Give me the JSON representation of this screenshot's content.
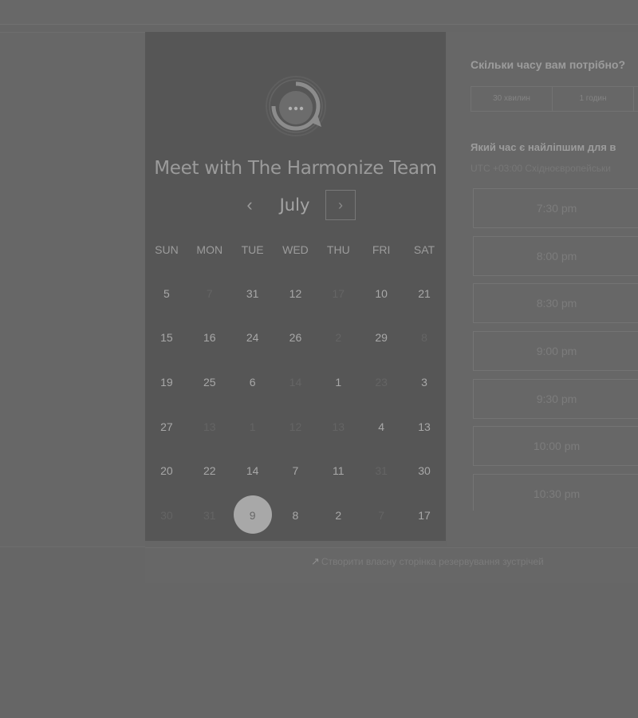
{
  "calendar": {
    "title": "Meet with The Harmonize Team",
    "month": "July",
    "prev_label": "‹",
    "next_label": "›",
    "weekdays": [
      "SUN",
      "MON",
      "TUE",
      "WED",
      "THU",
      "FRI",
      "SAT"
    ],
    "weeks": [
      [
        {
          "d": "5",
          "dim": false
        },
        {
          "d": "7",
          "dim": true
        },
        {
          "d": "31",
          "dim": false
        },
        {
          "d": "12",
          "dim": false
        },
        {
          "d": "17",
          "dim": true
        },
        {
          "d": "10",
          "dim": false
        },
        {
          "d": "21",
          "dim": false
        }
      ],
      [
        {
          "d": "15",
          "dim": false
        },
        {
          "d": "16",
          "dim": false
        },
        {
          "d": "24",
          "dim": false
        },
        {
          "d": "26",
          "dim": false
        },
        {
          "d": "2",
          "dim": true
        },
        {
          "d": "29",
          "dim": false
        },
        {
          "d": "8",
          "dim": true
        }
      ],
      [
        {
          "d": "19",
          "dim": false
        },
        {
          "d": "25",
          "dim": false
        },
        {
          "d": "6",
          "dim": false
        },
        {
          "d": "14",
          "dim": true
        },
        {
          "d": "1",
          "dim": false
        },
        {
          "d": "23",
          "dim": true
        },
        {
          "d": "3",
          "dim": false
        }
      ],
      [
        {
          "d": "27",
          "dim": false
        },
        {
          "d": "13",
          "dim": true
        },
        {
          "d": "1",
          "dim": true
        },
        {
          "d": "12",
          "dim": true
        },
        {
          "d": "13",
          "dim": true
        },
        {
          "d": "4",
          "dim": false
        },
        {
          "d": "13",
          "dim": false
        }
      ],
      [
        {
          "d": "20",
          "dim": false
        },
        {
          "d": "22",
          "dim": false
        },
        {
          "d": "14",
          "dim": false
        },
        {
          "d": "7",
          "dim": false
        },
        {
          "d": "11",
          "dim": false
        },
        {
          "d": "31",
          "dim": true
        },
        {
          "d": "30",
          "dim": false
        }
      ],
      [
        {
          "d": "30",
          "dim": true
        },
        {
          "d": "31",
          "dim": true
        },
        {
          "d": "9",
          "dim": false,
          "selected": true
        },
        {
          "d": "8",
          "dim": false
        },
        {
          "d": "2",
          "dim": false
        },
        {
          "d": "7",
          "dim": true
        },
        {
          "d": "17",
          "dim": false
        }
      ]
    ]
  },
  "booking": {
    "duration_question": "Скільки часу вам потрібно?",
    "durations": [
      "30 хвилин",
      "1 годин"
    ],
    "time_question": "Який час є найліпшим для в",
    "timezone": "UTC +03:00 Східноєвропейськи",
    "slots": [
      "7:30 pm",
      "8:00 pm",
      "8:30 pm",
      "9:00 pm",
      "9:30 pm",
      "10:00 pm",
      "10:30 pm"
    ]
  },
  "footer": {
    "link_icon": "↗",
    "link_text": "Створити власну сторінка резервування зустрічей"
  },
  "colors": {
    "background": "#666666",
    "calendar_panel": "#565656",
    "selected_day": "#a8a8a8"
  }
}
